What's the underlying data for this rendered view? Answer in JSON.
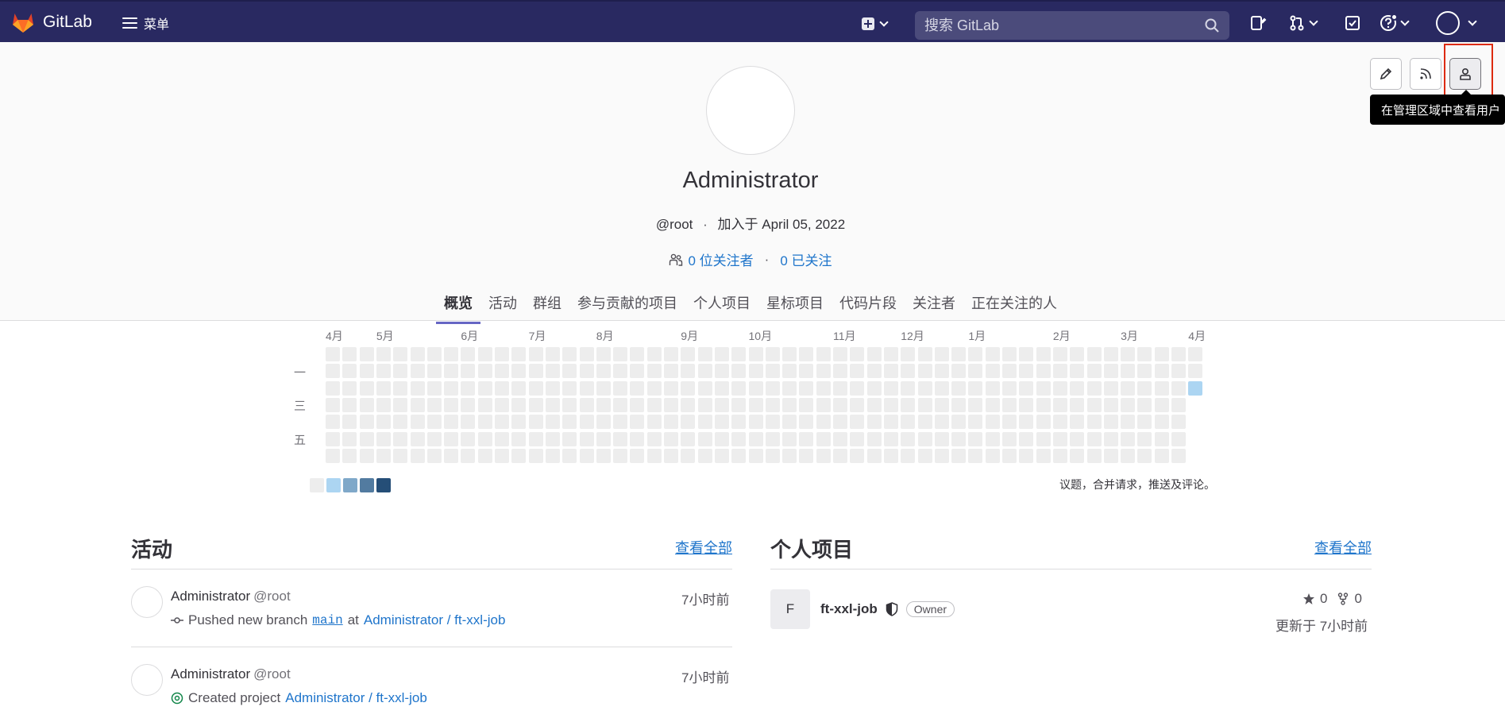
{
  "topbar": {
    "logo_text": "GitLab",
    "menu_label": "菜单",
    "search_placeholder": "搜索 GitLab",
    "colors": {
      "bar": "#292961",
      "logo_orange": "#fc6d26"
    }
  },
  "profile": {
    "name": "Administrator",
    "handle": "@root",
    "joined": "加入于 April 05, 2022",
    "followers": "0 位关注者",
    "following": "0 已关注",
    "action_tooltip": "在管理区域中查看用户"
  },
  "tabs": [
    "概览",
    "活动",
    "群组",
    "参与贡献的项目",
    "个人项目",
    "星标项目",
    "代码片段",
    "关注者",
    "正在关注的人"
  ],
  "calendar": {
    "months": [
      "4月",
      "5月",
      "6月",
      "7月",
      "8月",
      "9月",
      "10月",
      "11月",
      "12月",
      "1月",
      "2月",
      "3月",
      "4月"
    ],
    "day_labels": [
      "一",
      "三",
      "五"
    ],
    "legend_colors": [
      "#ededed",
      "#acd5f2",
      "#7fa8c9",
      "#527ba0",
      "#254e77"
    ],
    "active_day_color": "#acd5f2",
    "note": "议题，合并请求，推送及评论。"
  },
  "activity": {
    "title": "活动",
    "view_all": "查看全部",
    "items": [
      {
        "name": "Administrator",
        "handle": "@root",
        "time": "7小时前",
        "action": "Pushed new branch",
        "branch": "main",
        "at": "at",
        "project": "Administrator / ft-xxl-job"
      },
      {
        "name": "Administrator",
        "handle": "@root",
        "time": "7小时前",
        "action": "Created project",
        "project": "Administrator / ft-xxl-job"
      }
    ]
  },
  "projects": {
    "title": "个人项目",
    "view_all": "查看全部",
    "items": [
      {
        "avatar_letter": "F",
        "name": "ft-xxl-job",
        "role": "Owner",
        "stars": "0",
        "forks": "0",
        "updated": "更新于 7小时前"
      }
    ]
  }
}
